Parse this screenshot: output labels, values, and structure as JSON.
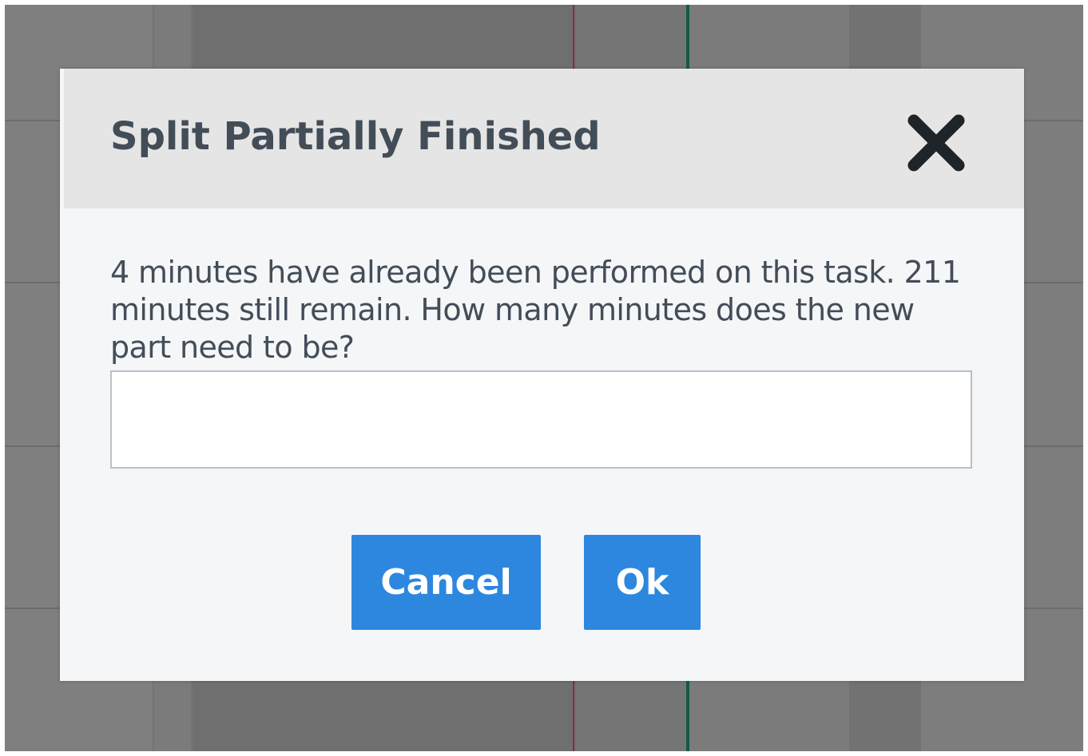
{
  "dialog": {
    "title": "Split Partially Finished",
    "close_icon": "close-icon",
    "prompt": "4 minutes have already been performed on this task. 211 minutes still remain. How many minutes does the new part need to be?",
    "input": {
      "value": "",
      "placeholder": ""
    },
    "buttons": {
      "cancel_label": "Cancel",
      "ok_label": "Ok"
    }
  },
  "colors": {
    "header_bg": "#e5e5e5",
    "body_bg": "#f4f6f8",
    "title_text": "#434d58",
    "button_bg": "#2d87de",
    "button_text": "#ffffff",
    "backdrop": "#7d7d7d"
  }
}
